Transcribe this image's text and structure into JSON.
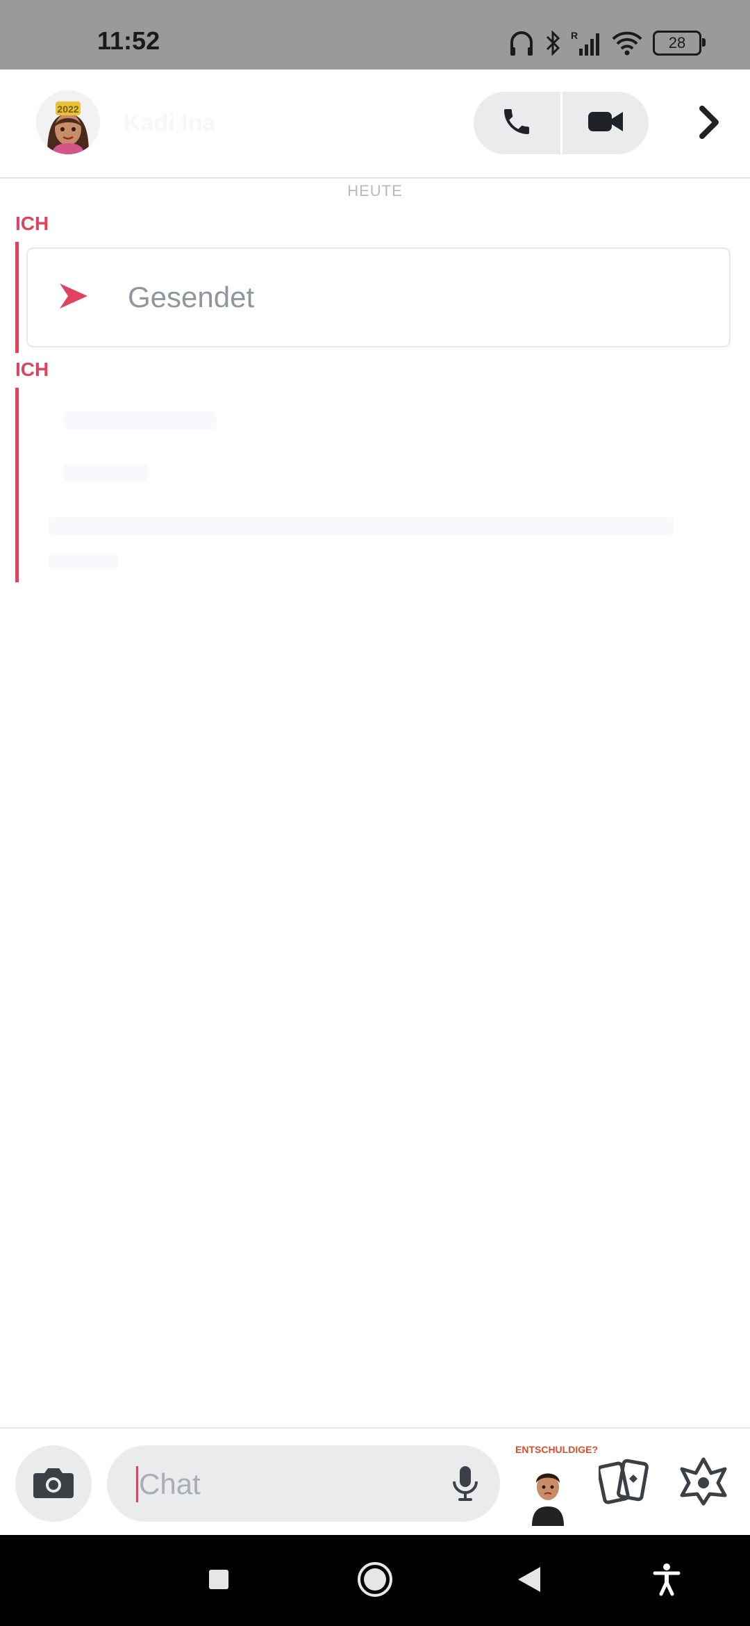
{
  "status_bar": {
    "time": "11:52",
    "battery": "28",
    "icons": [
      "headphones-icon",
      "bluetooth-icon",
      "signal-icon",
      "wifi-icon",
      "battery-icon"
    ]
  },
  "header": {
    "contact_name": "Kadi Ina",
    "call_icons": [
      "phone-icon",
      "video-icon"
    ],
    "next_icon": "chevron-right-icon"
  },
  "chat": {
    "date_separator": "HEUTE",
    "messages": [
      {
        "sender": "ICH",
        "status": "Gesendet"
      },
      {
        "sender": "ICH"
      }
    ]
  },
  "input_bar": {
    "placeholder": "Chat",
    "bitmoji_caption": "ENTSCHULDIGE?"
  },
  "colors": {
    "accent": "#e0435f",
    "status_bar_bg": "#9a9a9a",
    "pill_bg": "#eaebed",
    "nav_bg": "#000000"
  }
}
